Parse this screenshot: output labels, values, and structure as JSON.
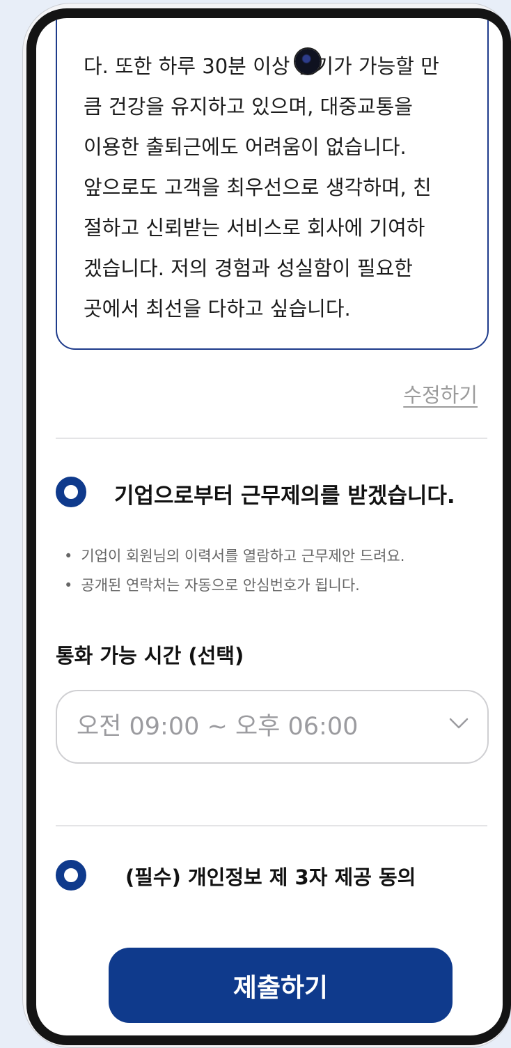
{
  "intro_text": {
    "lines": [
      "다. 또한 하루 30분 이상 걷기가 가능할 만",
      "큼 건강을 유지하고 있으며, 대중교통을",
      "이용한 출퇴근에도 어려움이 없습니다.",
      "앞으로도 고객을 최우선으로 생각하며, 친",
      "절하고 신뢰받는 서비스로 회사에 기여하",
      "겠습니다. 저의 경험과 성실함이 필요한",
      "곳에서 최선을 다하고 싶습니다."
    ]
  },
  "edit_link": "수정하기",
  "job_offer_option": {
    "label": "기업으로부터 근무제의를 받겠습니다.",
    "selected": true,
    "notes": [
      "기업이 회원님의 이력서를 열람하고 근무제안 드려요.",
      "공개된 연락처는 자동으로 안심번호가 됩니다."
    ]
  },
  "call_time": {
    "label": "통화 가능 시간 (선택)",
    "selected_value": "오전 09:00 ~ 오후 06:00",
    "icon": "chevron-down-icon"
  },
  "privacy_consent": {
    "label": "(필수) 개인정보 제 3자 제공 동의",
    "selected": true
  },
  "submit_button": "제출하기",
  "colors": {
    "accent": "#0f3a8c",
    "border": "#1e3b8b",
    "muted_text": "#9b9b9b",
    "background": "#e8eef8"
  }
}
